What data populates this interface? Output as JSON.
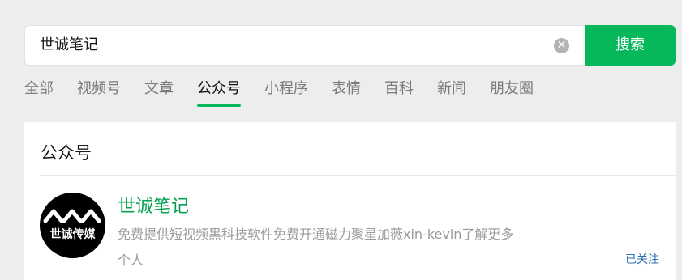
{
  "search": {
    "query": "世诚笔记",
    "clear_icon": "close-circle-icon",
    "button_label": "搜索",
    "button_color": "#07b85b"
  },
  "tabs": [
    {
      "label": "全部"
    },
    {
      "label": "视频号"
    },
    {
      "label": "文章"
    },
    {
      "label": "公众号",
      "active": true
    },
    {
      "label": "小程序"
    },
    {
      "label": "表情"
    },
    {
      "label": "百科"
    },
    {
      "label": "新闻"
    },
    {
      "label": "朋友圈"
    }
  ],
  "results": {
    "section_title": "公众号",
    "account": {
      "name": "世诚笔记",
      "avatar_text": "世诚传媒",
      "description": "免费提供短视频黑科技软件免费开通磁力聚星加薇xin-kevin了解更多",
      "type": "个人",
      "follow_status": "已关注"
    }
  },
  "colors": {
    "accent": "#07b85b",
    "account_name": "#07a14f",
    "link": "#2f6db3"
  }
}
